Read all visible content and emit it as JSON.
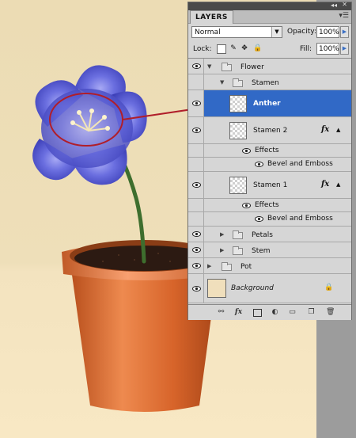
{
  "panel": {
    "tab_label": "LAYERS",
    "titlebar_collapse": "◂◂",
    "titlebar_close": "✕",
    "menu_icon": "menu-icon",
    "blend_mode": "Normal",
    "opacity_label": "Opacity:",
    "opacity_value": "100%",
    "lock_label": "Lock:",
    "fill_label": "Fill:",
    "fill_value": "100%"
  },
  "layers": [
    {
      "name": "Flower",
      "type": "group",
      "expanded": true,
      "visible": true
    },
    {
      "name": "Stamen",
      "type": "group",
      "expanded": true,
      "visible": false
    },
    {
      "name": "Anther",
      "type": "layer",
      "selected": true,
      "visible": true
    },
    {
      "name": "Stamen 2",
      "type": "layer",
      "visible": true,
      "fx": "fx",
      "effects_label": "Effects",
      "effect": "Bevel and Emboss"
    },
    {
      "name": "Stamen 1",
      "type": "layer",
      "visible": true,
      "fx": "fx",
      "effects_label": "Effects",
      "effect": "Bevel and Emboss"
    },
    {
      "name": "Petals",
      "type": "group",
      "expanded": false,
      "visible": true
    },
    {
      "name": "Stem",
      "type": "group",
      "expanded": false,
      "visible": true
    },
    {
      "name": "Pot",
      "type": "group",
      "expanded": false,
      "visible": true
    },
    {
      "name": "Background",
      "type": "background",
      "visible": true
    }
  ],
  "colors": {
    "selection": "#3169c6",
    "petal": "#5e63d6",
    "pot": "#d9662b",
    "annotation": "#b01e2a",
    "background_swatch": "#f0dfbc"
  }
}
